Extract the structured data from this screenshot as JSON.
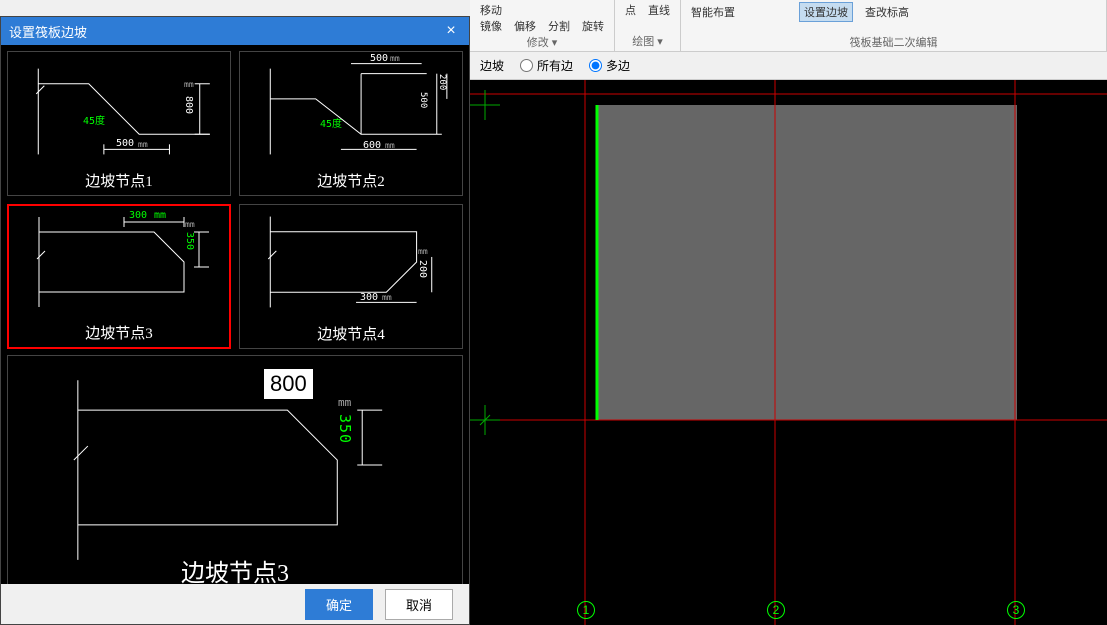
{
  "dialog": {
    "title": "设置筏板边坡",
    "nodes": [
      {
        "label": "边坡节点1",
        "angle": "45度",
        "dim1": "500",
        "dim2": "800"
      },
      {
        "label": "边坡节点2",
        "angle": "45度",
        "dim1": "600",
        "dim2": "500",
        "dim3": "500",
        "dim4": "200"
      },
      {
        "label": "边坡节点3",
        "dim1": "300",
        "dim2": "350"
      },
      {
        "label": "边坡节点4",
        "dim1": "300",
        "dim2": "200"
      }
    ],
    "selected_index": 2,
    "preview": {
      "label": "边坡节点3",
      "edit_value": "800",
      "dim_v": "350"
    },
    "ok_label": "确定",
    "cancel_label": "取消"
  },
  "ribbon": {
    "items1": {
      "a": "移动",
      "b": "",
      "c": "",
      "d": ""
    },
    "row2": {
      "a": "镜像",
      "b": "偏移",
      "c": "分割",
      "d": "旋转"
    },
    "group1_title": "修改 ▾",
    "group2": {
      "a": "点",
      "b": "直线",
      "c": ""
    },
    "group2_title": "绘图 ▾",
    "group3": {
      "a": "智能布置",
      "b": "",
      "c": "设置边坡",
      "d": "查改标高"
    },
    "group3_title": "筏板基础二次编辑",
    "current": "设置边坡"
  },
  "option_bar": {
    "label1": "边坡",
    "opt1": "所有边",
    "opt2": "多边"
  },
  "canvas": {
    "grid_labels": [
      "1",
      "2",
      "3"
    ]
  },
  "units": {
    "mm": "mm"
  }
}
